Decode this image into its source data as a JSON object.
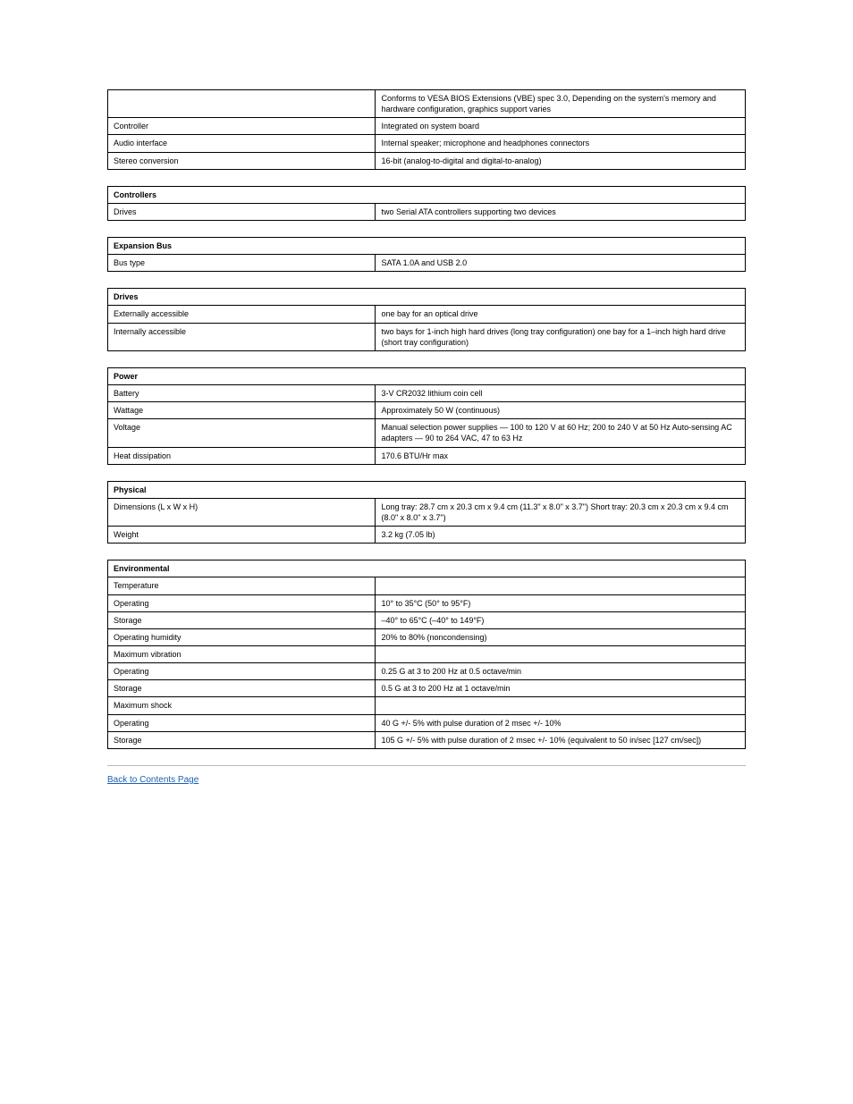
{
  "tables": [
    {
      "rows": [
        {
          "label": "",
          "value": "Conforms to VESA BIOS Extensions (VBE) spec 3.0, Depending on the system's memory and hardware configuration, graphics support varies"
        },
        {
          "label": "Controller",
          "value": "Integrated on system board"
        },
        {
          "label": "Audio interface",
          "value": "Internal speaker; microphone and headphones connectors"
        },
        {
          "label": "Stereo conversion",
          "value": "16-bit (analog-to-digital and digital-to-analog)"
        }
      ]
    },
    {
      "header": "Controllers",
      "rows": [
        {
          "label": "Drives",
          "value": "two Serial ATA controllers supporting two devices"
        }
      ]
    },
    {
      "header": "Expansion Bus",
      "rows": [
        {
          "label": "Bus type",
          "value": "SATA 1.0A and USB 2.0"
        }
      ]
    },
    {
      "header": "Drives",
      "rows": [
        {
          "label": "Externally accessible",
          "value": "one bay for an optical drive"
        },
        {
          "label": "Internally accessible",
          "value": "two bays for 1-inch high hard drives (long tray configuration) one bay for a 1–inch high hard drive (short tray configuration)"
        }
      ]
    },
    {
      "header": "Power",
      "rows": [
        {
          "label": "Battery",
          "value": "3-V CR2032 lithium coin cell"
        },
        {
          "label": "Wattage",
          "value": "Approximately 50 W (continuous)"
        },
        {
          "label": "Voltage",
          "value": "Manual selection power supplies —\n100 to 120 V at 60 Hz; 200 to 240 V at 50 Hz\nAuto-sensing AC adapters — 90 to 264 VAC, 47 to 63 Hz"
        },
        {
          "label": "Heat dissipation",
          "value": "170.6 BTU/Hr max"
        }
      ]
    },
    {
      "header": "Physical",
      "rows": [
        {
          "label": "Dimensions (L x W x H)",
          "value": "Long tray: 28.7 cm x 20.3 cm x 9.4 cm (11.3\" x 8.0\" x 3.7\") Short tray: 20.3 cm x 20.3 cm x 9.4 cm (8.0\" x 8.0\" x 3.7\")"
        },
        {
          "label": "Weight",
          "value": "3.2 kg (7.05 lb)"
        }
      ]
    },
    {
      "header": "Environmental",
      "rows": [
        {
          "label": "Temperature",
          "value": ""
        },
        {
          "label": "Operating",
          "value": "10° to 35°C (50° to 95°F)"
        },
        {
          "label": "Storage",
          "value": "–40° to 65°C (–40° to 149°F)"
        },
        {
          "label": "Operating humidity",
          "value": "20% to 80% (noncondensing)"
        },
        {
          "label": "Maximum vibration",
          "value": ""
        },
        {
          "label": "Operating",
          "value": "0.25 G at 3 to 200 Hz at 0.5 octave/min"
        },
        {
          "label": "Storage",
          "value": "0.5 G at 3 to 200 Hz at 1 octave/min"
        },
        {
          "label": "Maximum shock",
          "value": ""
        },
        {
          "label": "Operating",
          "value": "40 G +/- 5% with pulse duration of 2 msec +/- 10%"
        },
        {
          "label": "Storage",
          "value": "105 G +/- 5% with pulse duration of 2 msec +/- 10% (equivalent to 50 in/sec [127 cm/sec])"
        }
      ]
    }
  ],
  "link": "Back to Contents Page"
}
